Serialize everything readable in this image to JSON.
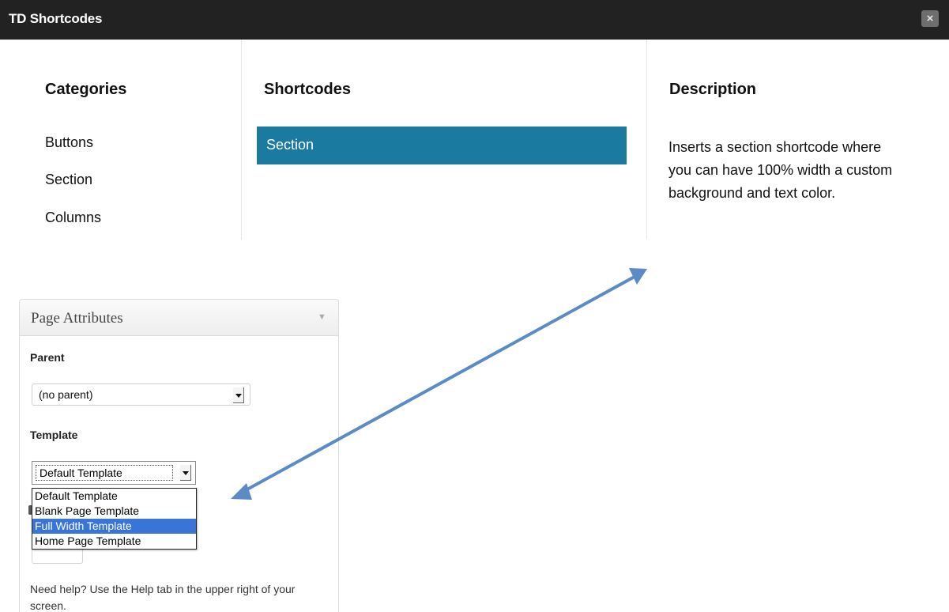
{
  "dialog": {
    "title": "TD Shortcodes",
    "close_label": "×"
  },
  "categories": {
    "heading": "Categories",
    "items": [
      "Buttons",
      "Section",
      "Columns"
    ]
  },
  "shortcodes": {
    "heading": "Shortcodes",
    "selected": "Section"
  },
  "description": {
    "heading": "Description",
    "text": "Inserts a section shortcode where you can have 100% width a custom background and text color."
  },
  "page_attributes": {
    "title": "Page Attributes",
    "toggle_icon": "triangle-down-icon",
    "parent_label": "Parent",
    "parent_value": "(no parent)",
    "template_label": "Template",
    "template_value": "Default Template",
    "template_options": [
      "Default Template",
      "Blank Page Template",
      "Full Width Template",
      "Home Page Template"
    ],
    "highlighted_option": "Full Width Template",
    "help_text": "Need help? Use the Help tab in the upper right of your screen."
  },
  "colors": {
    "titlebar": "#222222",
    "selected_shortcode": "#1a7aa0",
    "highlight": "#3875d7",
    "arrow": "#5b8ac5"
  }
}
